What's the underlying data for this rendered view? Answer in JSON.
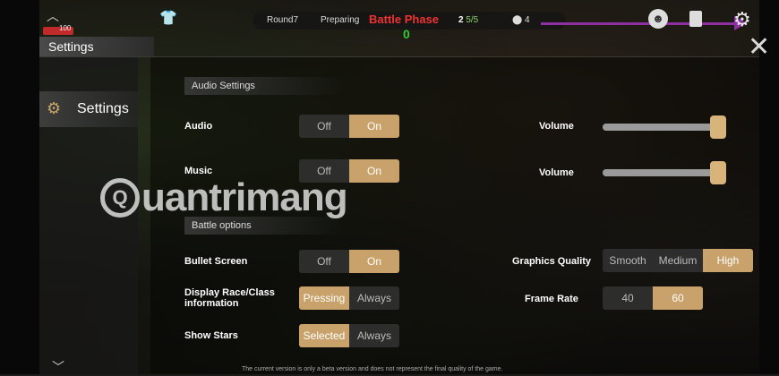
{
  "hud": {
    "hp": "100",
    "round": "Round7",
    "state": "Preparing",
    "phase": "Battle Phase",
    "phase_count": "0",
    "population": "5/5",
    "population_prefix": "2",
    "gold": "4"
  },
  "header": {
    "title": "Settings",
    "close_symbol": "✕"
  },
  "nav": {
    "items": [
      {
        "label": "Settings",
        "icon": "gear-icon"
      }
    ]
  },
  "audio_settings": {
    "title": "Audio Settings",
    "audio": {
      "label": "Audio",
      "off": "Off",
      "on": "On",
      "selected": "On"
    },
    "audio_volume": {
      "label": "Volume",
      "level": 1.0
    },
    "music": {
      "label": "Music",
      "off": "Off",
      "on": "On",
      "selected": "On"
    },
    "music_volume": {
      "label": "Volume",
      "level": 1.0
    }
  },
  "battle_options": {
    "title": "Battle options",
    "bullet_screen": {
      "label": "Bullet Screen",
      "off": "Off",
      "on": "On",
      "selected": "On"
    },
    "display_race": {
      "label": "Display Race/Class information",
      "pressing": "Pressing",
      "always": "Always",
      "selected": "Pressing"
    },
    "show_stars": {
      "label": "Show Stars",
      "selected_opt": "Selected",
      "always": "Always",
      "selected": "Selected"
    },
    "graphics_quality": {
      "label": "Graphics Quality",
      "options": [
        "Smooth",
        "Medium",
        "High"
      ],
      "selected": "High"
    },
    "frame_rate": {
      "label": "Frame Rate",
      "options": [
        "40",
        "60"
      ],
      "selected": "60"
    }
  },
  "watermark": {
    "text": "uantrimang",
    "logo_letter": "Q"
  },
  "footer": {
    "note": "The current version is only a beta version and does not represent the final quality of the game."
  },
  "colors": {
    "accent": "#c8a26a",
    "arrow": "#8e2fa2",
    "phase_red": "#e33333",
    "phase_green": "#2ecc2e"
  }
}
